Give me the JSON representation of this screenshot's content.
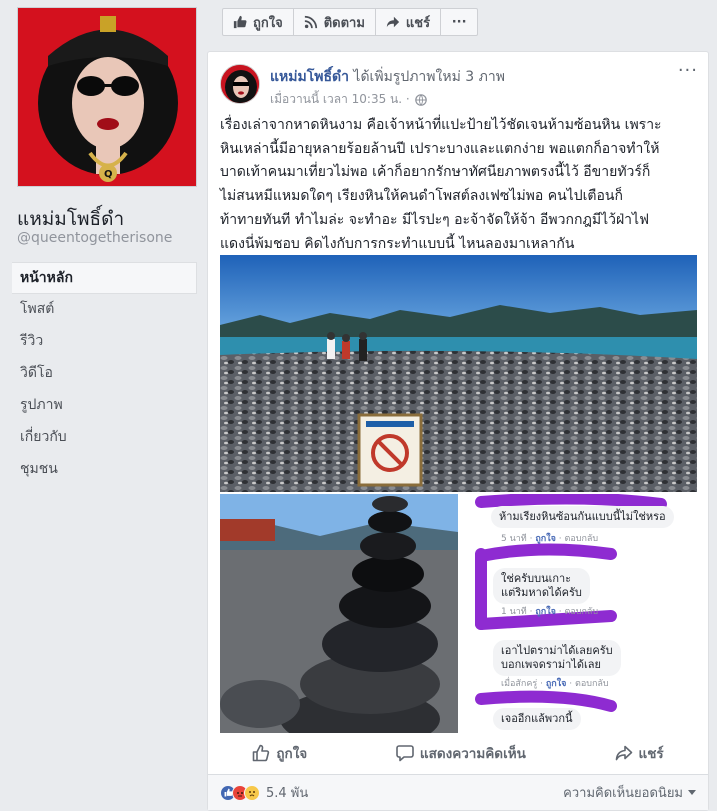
{
  "page": {
    "name": "แหม่มโพธิ์ดำ",
    "handle": "@queentogetherisone"
  },
  "nav": {
    "items": [
      {
        "label": "หน้าหลัก"
      },
      {
        "label": "โพสต์"
      },
      {
        "label": "รีวิว"
      },
      {
        "label": "วิดีโอ"
      },
      {
        "label": "รูปภาพ"
      },
      {
        "label": "เกี่ยวกับ"
      },
      {
        "label": "ชุมชน"
      }
    ]
  },
  "actionbar": {
    "like": "ถูกใจ",
    "follow": "ติดตาม",
    "share": "แชร์",
    "more": "···"
  },
  "post": {
    "author": "แหม่มโพธิ์ดำ",
    "action": "ได้เพิ่มรูปภาพใหม่ 3 ภาพ",
    "time": "เมื่อวานนี้ เวลา 10:35 น. ·",
    "menu": "···",
    "lines": [
      "เรื่องเล่าจากหาดหินงาม คือเจ้าหน้าที่แปะป้ายไว้ชัดเจนห้ามซ้อนหิน เพราะ",
      "หินเหล่านี้มีอายุหลายร้อยล้านปี เปราะบางและแตกง่าย พอแตกก็อาจทำให้",
      "บาดเท้าคนมาเที่ยวไม่พอ เค้าก็อยากรักษาทัศนียภาพตรงนี้ไว้ อีขายทัวร์ก็",
      "ไม่สนหมีแหมดใดๆ เรียงหินให้คนดำโพสต์ลงเฟซไม่พอ คนไปเตือนก็",
      "ท้าทายทันที ทำไมล่ะ จะทำอะ มีไรปะๆ อะจ้าจัดให้จ้า อีพวกกฎมีไว้ฝ่าไฟ",
      "แดงนี่พ้มชอบ คิดไงกับการกระทำแบบนี้ ไหนลองมาเหลากัน"
    ],
    "comments_shot": {
      "c1": "ห้ามเรียงหินซ้อนกันแบบนี้ไม่ใช่หรอ",
      "c1_time": "5 นาที",
      "c2a": "ใช่ครับบนเกาะ",
      "c2b": "แต่ริมหาดได้ครับ",
      "c2_time": "1 นาที",
      "c3a": "เอาไปตราม่าได้เลยครับ",
      "c3b": "บอกเพจดราม่าได้เลย",
      "c3_time": "เมื่อสักครู่",
      "c4": "เจออีกแล้พวกนี้",
      "like": "ถูกใจ",
      "reply": "ตอบกลับ"
    },
    "actions": {
      "like": "ถูกใจ",
      "comment": "แสดงความคิดเห็น",
      "share": "แชร์"
    },
    "reaction_count": "5.4 พัน",
    "sort": "ความคิดเห็นยอดนิยม"
  },
  "colors": {
    "fb_blue": "#365899",
    "like_blue": "#4267b2",
    "avatar_red": "#d4111e"
  }
}
